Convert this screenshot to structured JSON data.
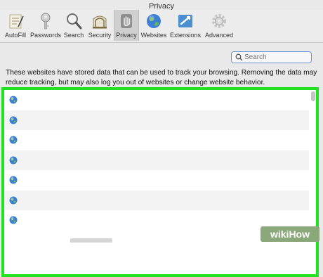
{
  "window": {
    "title": "Privacy"
  },
  "toolbar": {
    "items": [
      {
        "label": "AutoFill",
        "icon": "autofill-icon"
      },
      {
        "label": "Passwords",
        "icon": "key-icon"
      },
      {
        "label": "Search",
        "icon": "magnifier-icon"
      },
      {
        "label": "Security",
        "icon": "security-icon"
      },
      {
        "label": "Privacy",
        "icon": "hand-icon",
        "selected": true
      },
      {
        "label": "Websites",
        "icon": "globe-icon"
      },
      {
        "label": "Extensions",
        "icon": "puzzle-icon"
      },
      {
        "label": "Advanced",
        "icon": "gear-icon"
      }
    ]
  },
  "search": {
    "placeholder": "Search"
  },
  "description": "These websites have stored data that can be used to track your browsing. Removing the data may reduce tracking, but may also log you out of websites or change website behavior.",
  "website_list": {
    "rows": 7,
    "row_icon": "globe-icon"
  },
  "colors": {
    "highlight": "#22e022",
    "search_focus": "#6b8fd8",
    "selected_tab": "#cfcfcf"
  },
  "watermark": {
    "text": "wikiHow"
  }
}
